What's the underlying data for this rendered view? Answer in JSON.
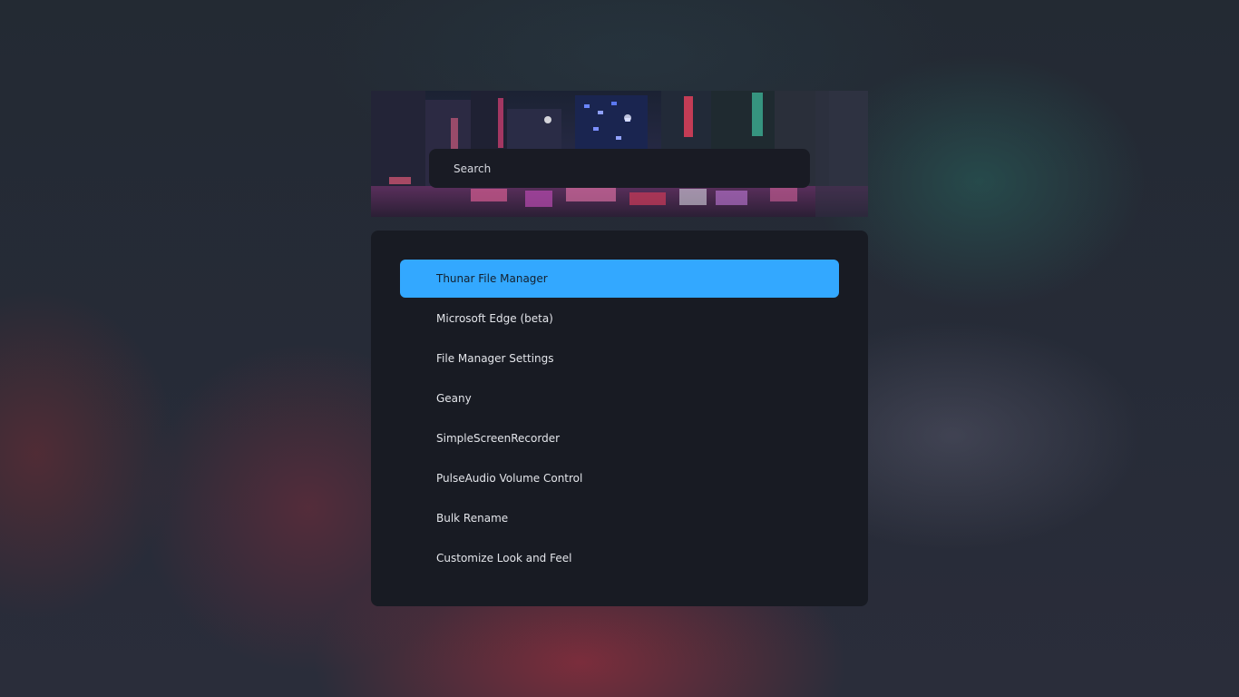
{
  "search": {
    "placeholder": "Search",
    "value": ""
  },
  "results": [
    {
      "label": "Thunar File Manager",
      "selected": true
    },
    {
      "label": "Microsoft Edge (beta)",
      "selected": false
    },
    {
      "label": "File Manager Settings",
      "selected": false
    },
    {
      "label": "Geany",
      "selected": false
    },
    {
      "label": "SimpleScreenRecorder",
      "selected": false
    },
    {
      "label": "PulseAudio Volume Control",
      "selected": false
    },
    {
      "label": "Bulk Rename",
      "selected": false
    },
    {
      "label": "Customize Look and Feel",
      "selected": false
    }
  ],
  "colors": {
    "accent": "#33a8ff",
    "panel": "#181b23",
    "search_bg": "#191b24",
    "text": "#e3e5ea"
  }
}
